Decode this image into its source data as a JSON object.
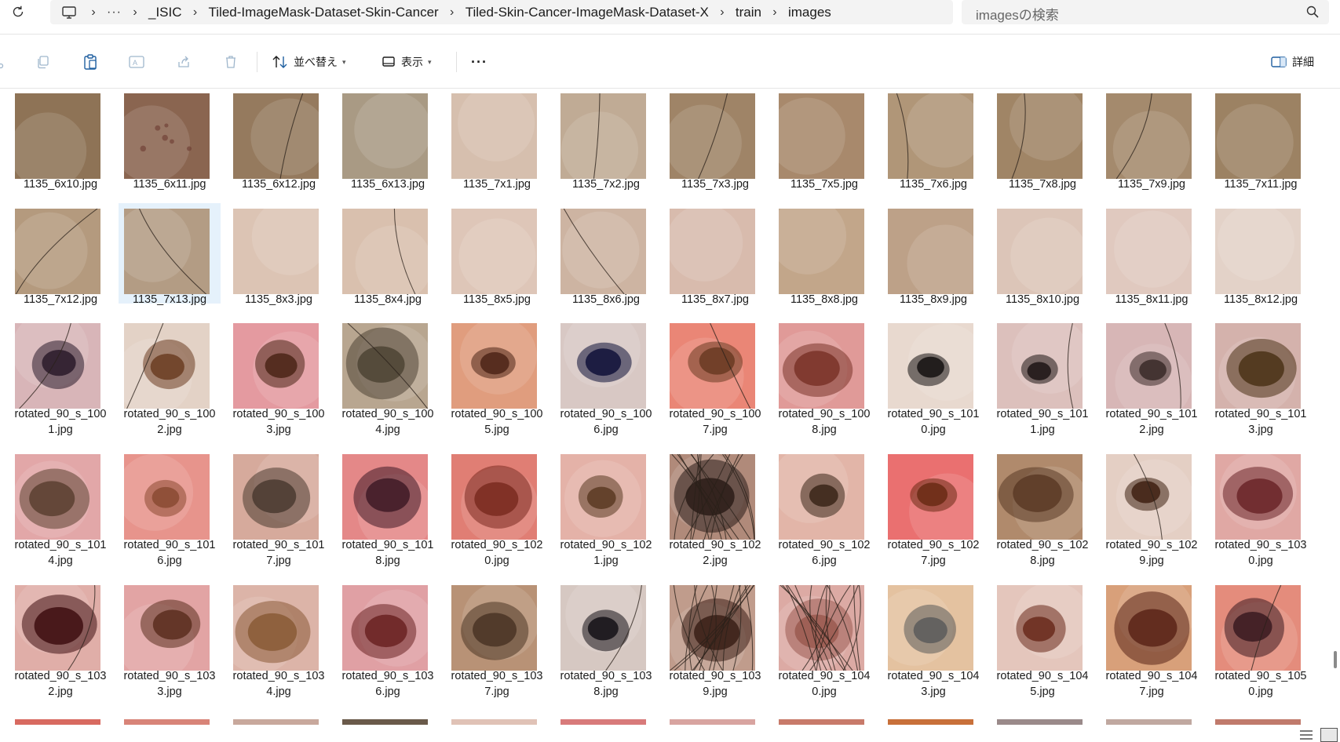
{
  "address": {
    "breadcrumb": [
      "_ISIC",
      "Tiled-ImageMask-Dataset-Skin-Cancer",
      "Tiled-Skin-Cancer-ImageMask-Dataset-X",
      "train",
      "images"
    ],
    "more": "···",
    "search_placeholder": "imagesの検索"
  },
  "toolbar": {
    "sort_label": "並べ替え",
    "view_label": "表示",
    "more_label": "···",
    "details_label": "詳細"
  },
  "files": [
    {
      "label": "1135_6x10.jpg",
      "kind": "skin",
      "base": "#8e7356",
      "hair": 0,
      "spot": 0,
      "selected": false
    },
    {
      "label": "1135_6x11.jpg",
      "kind": "skin",
      "base": "#8a6550",
      "hair": 0,
      "spot": 1,
      "selected": false
    },
    {
      "label": "1135_6x12.jpg",
      "kind": "skin",
      "base": "#957a5e",
      "hair": 1,
      "spot": 0,
      "selected": false
    },
    {
      "label": "1135_6x13.jpg",
      "kind": "skin",
      "base": "#a99a84",
      "hair": 0,
      "spot": 0,
      "selected": false
    },
    {
      "label": "1135_7x1.jpg",
      "kind": "skin",
      "base": "#d6bfae",
      "hair": 0,
      "spot": 0,
      "selected": false
    },
    {
      "label": "1135_7x2.jpg",
      "kind": "skin",
      "base": "#c0ab95",
      "hair": 1,
      "spot": 0,
      "selected": false
    },
    {
      "label": "1135_7x3.jpg",
      "kind": "skin",
      "base": "#9f8467",
      "hair": 1,
      "spot": 0,
      "selected": false
    },
    {
      "label": "1135_7x5.jpg",
      "kind": "skin",
      "base": "#a8896c",
      "hair": 0,
      "spot": 0,
      "selected": false
    },
    {
      "label": "1135_7x6.jpg",
      "kind": "skin",
      "base": "#b09678",
      "hair": 1,
      "spot": 0,
      "selected": false
    },
    {
      "label": "1135_7x8.jpg",
      "kind": "skin",
      "base": "#a08566",
      "hair": 1,
      "spot": 0,
      "selected": false
    },
    {
      "label": "1135_7x9.jpg",
      "kind": "skin",
      "base": "#a48a6d",
      "hair": 1,
      "spot": 0,
      "selected": false
    },
    {
      "label": "1135_7x11.jpg",
      "kind": "skin",
      "base": "#9c8263",
      "hair": 0,
      "spot": 0,
      "selected": false
    },
    {
      "label": "1135_7x12.jpg",
      "kind": "skin",
      "base": "#b49a7e",
      "hair": 1,
      "spot": 0,
      "selected": false
    },
    {
      "label": "1135_7x13.jpg",
      "kind": "skin",
      "base": "#b39c84",
      "hair": 1,
      "spot": 0,
      "selected": true
    },
    {
      "label": "1135_8x3.jpg",
      "kind": "skin",
      "base": "#dcc4b4",
      "hair": 0,
      "spot": 0,
      "selected": false
    },
    {
      "label": "1135_8x4.jpg",
      "kind": "skin",
      "base": "#d9c0ae",
      "hair": 1,
      "spot": 0,
      "selected": false
    },
    {
      "label": "1135_8x5.jpg",
      "kind": "skin",
      "base": "#dec6b8",
      "hair": 0,
      "spot": 0,
      "selected": false
    },
    {
      "label": "1135_8x6.jpg",
      "kind": "skin",
      "base": "#cdb4a2",
      "hair": 1,
      "spot": 0,
      "selected": false
    },
    {
      "label": "1135_8x7.jpg",
      "kind": "skin",
      "base": "#d8bbad",
      "hair": 0,
      "spot": 0,
      "selected": false
    },
    {
      "label": "1135_8x8.jpg",
      "kind": "skin",
      "base": "#c2a68a",
      "hair": 0,
      "spot": 0,
      "selected": false
    },
    {
      "label": "1135_8x9.jpg",
      "kind": "skin",
      "base": "#bda188",
      "hair": 0,
      "spot": 0,
      "selected": false
    },
    {
      "label": "1135_8x10.jpg",
      "kind": "skin",
      "base": "#dcc5b8",
      "hair": 0,
      "spot": 0,
      "selected": false
    },
    {
      "label": "1135_8x11.jpg",
      "kind": "skin",
      "base": "#e0c9bf",
      "hair": 0,
      "spot": 0,
      "selected": false
    },
    {
      "label": "1135_8x12.jpg",
      "kind": "skin",
      "base": "#e3d2c8",
      "hair": 0,
      "spot": 0,
      "selected": false
    },
    {
      "label": "rotated_90_s_1001.jpg",
      "kind": "lesion",
      "base": "#d8b5b8",
      "lesion": "#2a1a2a",
      "size": 0.55,
      "hair": 1,
      "selected": false
    },
    {
      "label": "rotated_90_s_1002.jpg",
      "kind": "lesion",
      "base": "#e3d2c6",
      "lesion": "#6b3d22",
      "size": 0.55,
      "hair": 1,
      "selected": false
    },
    {
      "label": "rotated_90_s_1003.jpg",
      "kind": "lesion",
      "base": "#e49aa0",
      "lesion": "#4a2416",
      "size": 0.5,
      "hair": 0,
      "selected": false
    },
    {
      "label": "rotated_90_s_1004.jpg",
      "kind": "lesion",
      "base": "#b8a690",
      "lesion": "#4e4434",
      "size": 0.95,
      "hair": 1,
      "selected": false
    },
    {
      "label": "rotated_90_s_1005.jpg",
      "kind": "lesion",
      "base": "#e09d7e",
      "lesion": "#4d2418",
      "size": 0.4,
      "hair": 0,
      "selected": false
    },
    {
      "label": "rotated_90_s_1006.jpg",
      "kind": "lesion",
      "base": "#d8c8c4",
      "lesion": "#0f1138",
      "size": 0.6,
      "hair": 0,
      "selected": false
    },
    {
      "label": "rotated_90_s_1007.jpg",
      "kind": "lesion",
      "base": "#ea8676",
      "lesion": "#6a3a22",
      "size": 0.6,
      "hair": 1,
      "selected": false
    },
    {
      "label": "rotated_90_s_1008.jpg",
      "kind": "lesion",
      "base": "#e09a98",
      "lesion": "#7a3328",
      "size": 0.9,
      "hair": 0,
      "selected": false
    },
    {
      "label": "rotated_90_s_1010.jpg",
      "kind": "lesion",
      "base": "#e8d9cf",
      "lesion": "#141010",
      "size": 0.35,
      "hair": 0,
      "selected": false
    },
    {
      "label": "rotated_90_s_1011.jpg",
      "kind": "lesion",
      "base": "#dcc0bc",
      "lesion": "#1d1414",
      "size": 0.25,
      "hair": 1,
      "selected": false
    },
    {
      "label": "rotated_90_s_1012.jpg",
      "kind": "lesion",
      "base": "#d7b6b6",
      "lesion": "#3a2a28",
      "size": 0.35,
      "hair": 1,
      "selected": false
    },
    {
      "label": "rotated_90_s_1013.jpg",
      "kind": "lesion",
      "base": "#d4b2ac",
      "lesion": "#4a3216",
      "size": 0.9,
      "hair": 0,
      "selected": false
    },
    {
      "label": "rotated_90_s_1014.jpg",
      "kind": "lesion",
      "base": "#e2a7a8",
      "lesion": "#5b4030",
      "size": 0.9,
      "hair": 0,
      "selected": false
    },
    {
      "label": "rotated_90_s_1016.jpg",
      "kind": "lesion",
      "base": "#e7948c",
      "lesion": "#8a4a32",
      "size": 0.35,
      "hair": 0,
      "selected": false
    },
    {
      "label": "rotated_90_s_1017.jpg",
      "kind": "lesion",
      "base": "#d6aa9c",
      "lesion": "#4a3a30",
      "size": 0.85,
      "hair": 0,
      "selected": false
    },
    {
      "label": "rotated_90_s_1018.jpg",
      "kind": "lesion",
      "base": "#e48888",
      "lesion": "#3e1a26",
      "size": 0.85,
      "hair": 0,
      "selected": false
    },
    {
      "label": "rotated_90_s_1020.jpg",
      "kind": "lesion",
      "base": "#e07e74",
      "lesion": "#7a2a20",
      "size": 0.85,
      "hair": 0,
      "selected": false
    },
    {
      "label": "rotated_90_s_1021.jpg",
      "kind": "lesion",
      "base": "#e4b2a8",
      "lesion": "#5a3a22",
      "size": 0.4,
      "hair": 0,
      "selected": false
    },
    {
      "label": "rotated_90_s_1022.jpg",
      "kind": "lesion",
      "base": "#b08a7a",
      "lesion": "#2a1c18",
      "size": 1.0,
      "hair": 2,
      "selected": false
    },
    {
      "label": "rotated_90_s_1026.jpg",
      "kind": "lesion",
      "base": "#e2b5a8",
      "lesion": "#3a2418",
      "size": 0.4,
      "hair": 0,
      "selected": false
    },
    {
      "label": "rotated_90_s_1027.jpg",
      "kind": "lesion",
      "base": "#ea7070",
      "lesion": "#6a2a14",
      "size": 0.45,
      "hair": 0,
      "selected": false
    },
    {
      "label": "rotated_90_s_1028.jpg",
      "kind": "lesion",
      "base": "#b08a6c",
      "lesion": "#5a3a26",
      "size": 1.0,
      "hair": 0,
      "selected": false
    },
    {
      "label": "rotated_90_s_1029.jpg",
      "kind": "lesion",
      "base": "#e4cfc4",
      "lesion": "#3e2012",
      "size": 0.4,
      "hair": 1,
      "selected": false
    },
    {
      "label": "rotated_90_s_1030.jpg",
      "kind": "lesion",
      "base": "#e0a8a4",
      "lesion": "#6a2428",
      "size": 0.9,
      "hair": 0,
      "selected": false
    },
    {
      "label": "rotated_90_s_1032.jpg",
      "kind": "lesion",
      "base": "#e0aea8",
      "lesion": "#3e0e10",
      "size": 1.0,
      "hair": 1,
      "selected": false
    },
    {
      "label": "rotated_90_s_1033.jpg",
      "kind": "lesion",
      "base": "#e2a4a4",
      "lesion": "#5a2e1e",
      "size": 0.7,
      "hair": 0,
      "selected": false
    },
    {
      "label": "rotated_90_s_1034.jpg",
      "kind": "lesion",
      "base": "#dcb4a8",
      "lesion": "#8a5a36",
      "size": 1.0,
      "hair": 0,
      "selected": false
    },
    {
      "label": "rotated_90_s_1036.jpg",
      "kind": "lesion",
      "base": "#e0a0a4",
      "lesion": "#6a2222",
      "size": 0.8,
      "hair": 0,
      "selected": false
    },
    {
      "label": "rotated_90_s_1037.jpg",
      "kind": "lesion",
      "base": "#b89276",
      "lesion": "#4a3424",
      "size": 0.85,
      "hair": 0,
      "selected": false
    },
    {
      "label": "rotated_90_s_1038.jpg",
      "kind": "lesion",
      "base": "#d6c8c2",
      "lesion": "#141016",
      "size": 0.45,
      "hair": 1,
      "selected": false
    },
    {
      "label": "rotated_90_s_1039.jpg",
      "kind": "lesion",
      "base": "#c09c8c",
      "lesion": "#3a1e16",
      "size": 0.9,
      "hair": 2,
      "selected": false
    },
    {
      "label": "rotated_90_s_1040.jpg",
      "kind": "lesion",
      "base": "#dcaaa4",
      "lesion": "#9a5a50",
      "size": 0.85,
      "hair": 2,
      "selected": false
    },
    {
      "label": "rotated_90_s_1043.jpg",
      "kind": "lesion",
      "base": "#e4c2a0",
      "lesion": "#5a5a5a",
      "size": 0.55,
      "hair": 0,
      "selected": false
    },
    {
      "label": "rotated_90_s_1045.jpg",
      "kind": "lesion",
      "base": "#e4c6bc",
      "lesion": "#6a2a1c",
      "size": 0.5,
      "hair": 0,
      "selected": false
    },
    {
      "label": "rotated_90_s_1047.jpg",
      "kind": "lesion",
      "base": "#d8a07a",
      "lesion": "#5a2418",
      "size": 1.0,
      "hair": 0,
      "selected": false
    },
    {
      "label": "rotated_90_s_1050.jpg",
      "kind": "lesion",
      "base": "#e48c7c",
      "lesion": "#3a1a20",
      "size": 0.7,
      "hair": 1,
      "selected": false
    }
  ],
  "partial_row": [
    {
      "base": "#d86a60"
    },
    {
      "base": "#d88478"
    },
    {
      "base": "#c8a89c"
    },
    {
      "base": "#6a5a4a"
    },
    {
      "base": "#e0c2b6"
    },
    {
      "base": "#d87a7a"
    },
    {
      "base": "#d8a4a0"
    },
    {
      "base": "#c87a6a"
    },
    {
      "base": "#c8703a"
    },
    {
      "base": "#9a8a8a"
    },
    {
      "base": "#c0a8a0"
    },
    {
      "base": "#c07a6c"
    }
  ]
}
